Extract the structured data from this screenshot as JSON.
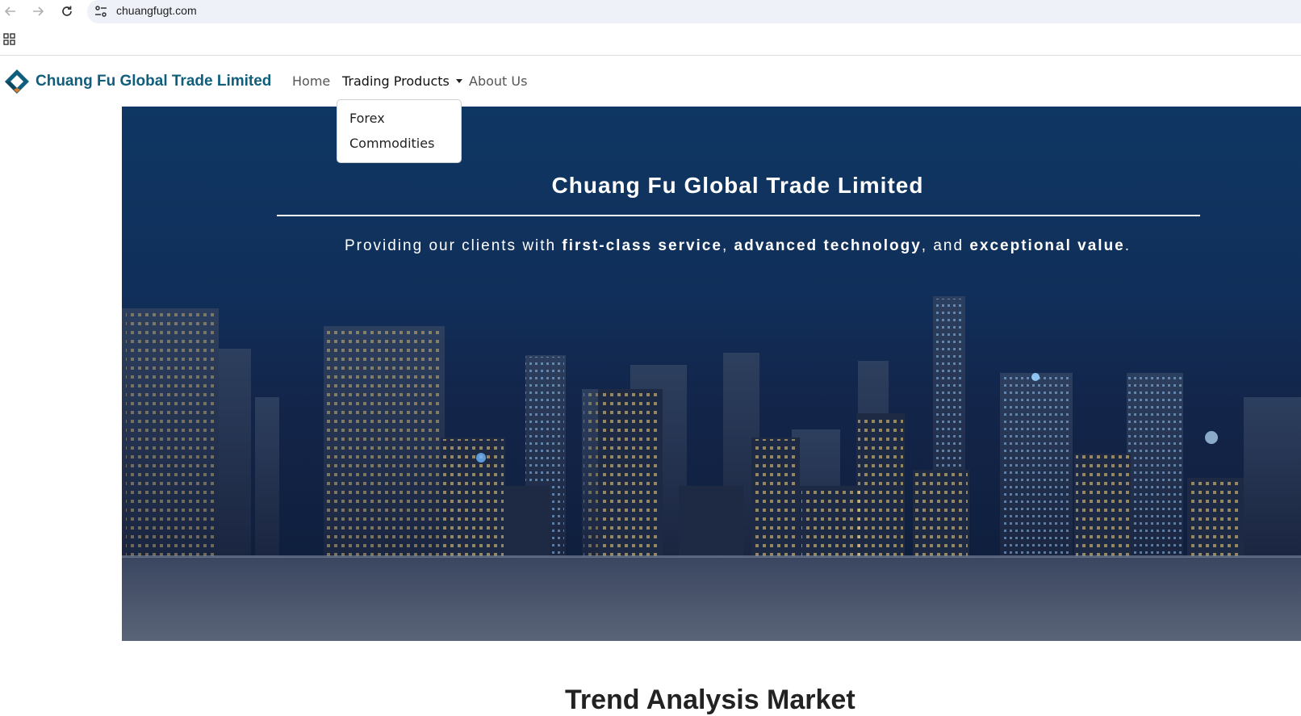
{
  "browser": {
    "url": "chuangfugt.com"
  },
  "site": {
    "brand_name": "Chuang Fu Global Trade Limited",
    "brand_color": "#0f5f7c",
    "nav": {
      "home": "Home",
      "trading_products": "Trading Products",
      "about_us": "About Us"
    },
    "dropdown": {
      "items": [
        "Forex",
        "Commodities"
      ]
    }
  },
  "hero": {
    "title": "Chuang Fu Global Trade Limited",
    "tagline": {
      "prefix": "Providing our clients with ",
      "strong1": "first-class service",
      "sep1": ", ",
      "strong2": "advanced technology",
      "sep2": ", and ",
      "strong3": "exceptional value",
      "suffix": "."
    }
  },
  "next_section": {
    "heading": "Trend Analysis Market"
  }
}
